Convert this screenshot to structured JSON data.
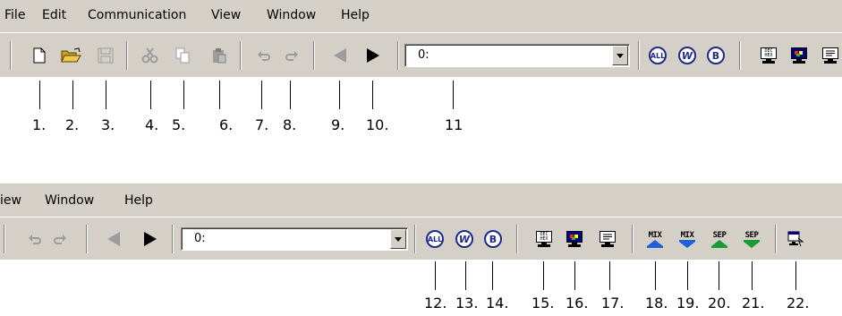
{
  "menu": {
    "file": "File",
    "edit": "Edit",
    "communication": "Communication",
    "view": "View",
    "window": "Window",
    "help": "Help"
  },
  "menu2": {
    "view_partial": "iew",
    "window": "Window",
    "help": "Help"
  },
  "combo": {
    "value": "0:"
  },
  "toolbar_icons": [
    "new-file-icon",
    "open-folder-icon",
    "save-icon",
    "cut-icon",
    "copy-icon",
    "paste-icon",
    "undo-icon",
    "redo-icon",
    "back-arrow-icon",
    "forward-arrow-icon",
    "address-combobox",
    "all-icon",
    "w-icon",
    "b-icon",
    "dec-hex-monitor-icon",
    "color-monitor-icon",
    "text-monitor-icon",
    "mix-up-icon",
    "mix-down-icon",
    "sep-up-icon",
    "sep-down-icon",
    "window-arrange-icon"
  ],
  "mix_label": "MIX",
  "sep_label": "SEP",
  "callouts_top": [
    "1.",
    "2.",
    "3.",
    "4.",
    "5.",
    "6.",
    "7.",
    "8.",
    "9.",
    "10.",
    "11"
  ],
  "callouts_bottom": [
    "12.",
    "13.",
    "14.",
    "15.",
    "16.",
    "17.",
    "18.",
    "19.",
    "20.",
    "21.",
    "22."
  ],
  "colors": {
    "face": "#d4d0c8",
    "accent_blue": "#1f2a8a",
    "arrow_blue": "#2060d8",
    "arrow_green": "#1a9a30"
  }
}
